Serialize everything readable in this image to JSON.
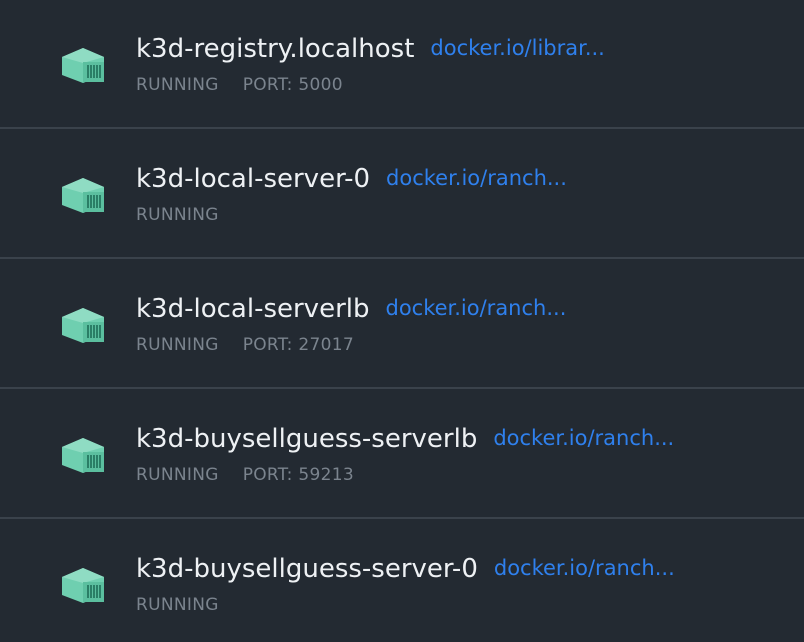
{
  "icon_color": "#6fcfb0",
  "containers": [
    {
      "name": "k3d-registry.localhost",
      "image": "docker.io/librar...",
      "status": "RUNNING",
      "port": "PORT: 5000",
      "icon": "container-icon"
    },
    {
      "name": "k3d-local-server-0",
      "image": "docker.io/ranch...",
      "status": "RUNNING",
      "port": "",
      "icon": "container-icon"
    },
    {
      "name": "k3d-local-serverlb",
      "image": "docker.io/ranch...",
      "status": "RUNNING",
      "port": "PORT: 27017",
      "icon": "container-icon"
    },
    {
      "name": "k3d-buysellguess-serverlb",
      "image": "docker.io/ranch...",
      "status": "RUNNING",
      "port": "PORT: 59213",
      "icon": "container-icon"
    },
    {
      "name": "k3d-buysellguess-server-0",
      "image": "docker.io/ranch...",
      "status": "RUNNING",
      "port": "",
      "icon": "container-icon"
    }
  ]
}
